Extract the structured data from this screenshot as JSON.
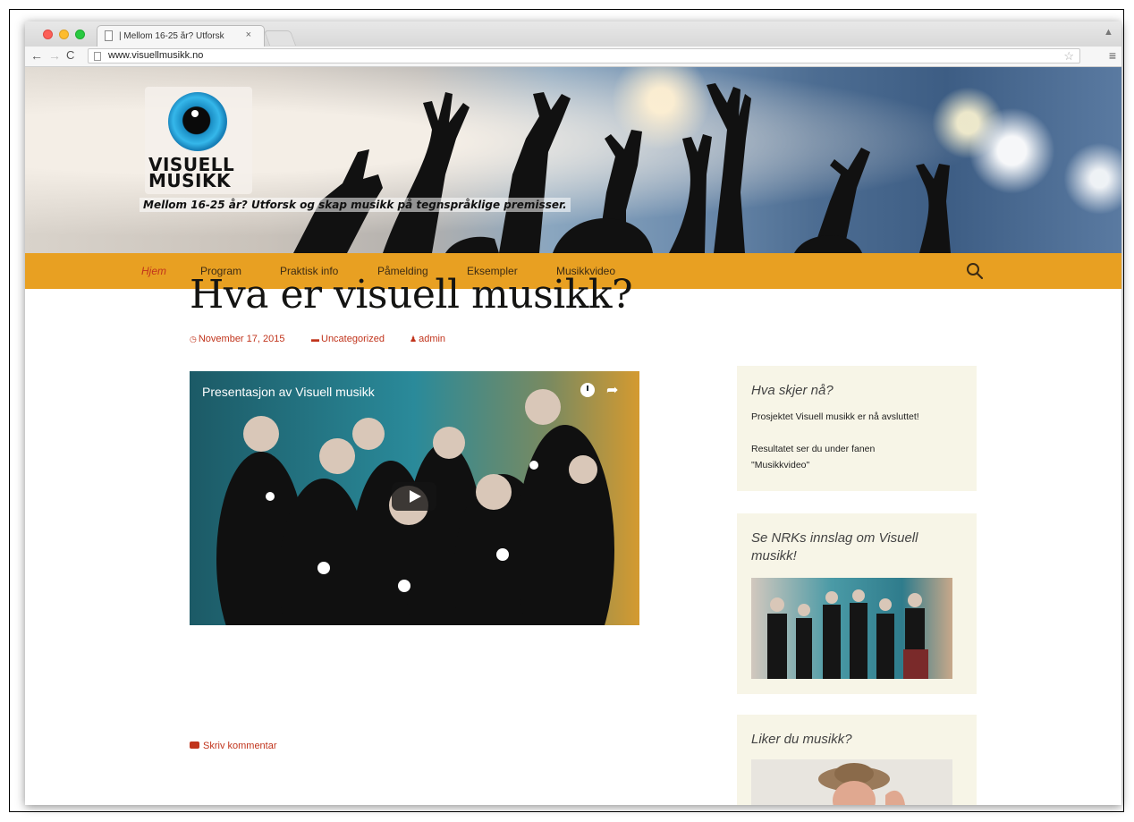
{
  "browser": {
    "tab_title": "| Mellom 16-25 år? Utforsk",
    "tab_close": "×",
    "url": "www.visuellmusikk.no"
  },
  "site": {
    "logo_line1": "VISUELL",
    "logo_line2": "MUSIKK",
    "tagline": "Mellom 16-25 år? Utforsk og skap musikk på tegnspråklige premisser.",
    "nav": [
      "Hjem",
      "Program",
      "Praktisk info",
      "Påmelding",
      "Eksempler",
      "Musikkvideo"
    ],
    "active_nav": "Hjem",
    "accent_color": "#e8a022",
    "link_color": "#c1341c"
  },
  "post": {
    "title": "Hva er visuell musikk?",
    "date": "November 17, 2015",
    "category": "Uncategorized",
    "author": "admin",
    "video_title": "Presentasjon av Visuell musikk",
    "comment_label": "Skriv kommentar"
  },
  "sidebar": {
    "widget1": {
      "title": "Hva skjer nå?",
      "line1": "Prosjektet Visuell musikk er nå avsluttet!",
      "line2": "Resultatet ser du under fanen",
      "line3": "\"Musikkvideo\""
    },
    "widget2": {
      "title_line1": "Se NRKs innslag om Visuell",
      "title_line2": "musikk!"
    },
    "widget3": {
      "title": "Liker du musikk?"
    }
  }
}
